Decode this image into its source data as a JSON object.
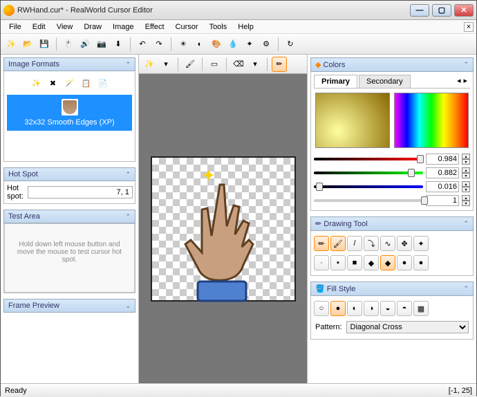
{
  "title": "RWHand.cur* - RealWorld Cursor Editor",
  "menu": [
    "File",
    "Edit",
    "View",
    "Draw",
    "Image",
    "Effect",
    "Cursor",
    "Tools",
    "Help"
  ],
  "panels": {
    "image_formats": {
      "title": "Image Formats",
      "item": "32x32 Smooth Edges (XP)"
    },
    "hot_spot": {
      "title": "Hot Spot",
      "label": "Hot spot:",
      "value": "7, 1"
    },
    "test_area": {
      "title": "Test Area",
      "hint": "Hold down left mouse button and move the mouse to test cursor hot spot."
    },
    "frame_preview": {
      "title": "Frame Preview"
    },
    "colors": {
      "title": "Colors",
      "tabs": [
        "Primary",
        "Secondary"
      ],
      "sliders": [
        {
          "value": "0.984",
          "pos": 94,
          "color": "#c00"
        },
        {
          "value": "0.882",
          "pos": 86,
          "color": "#0a0"
        },
        {
          "value": "0.016",
          "pos": 2,
          "color": "#00c"
        },
        {
          "value": "1",
          "pos": 98,
          "color": "#888"
        }
      ]
    },
    "drawing_tool": {
      "title": "Drawing Tool"
    },
    "fill_style": {
      "title": "Fill Style",
      "pattern_label": "Pattern:",
      "pattern_value": "Diagonal Cross"
    }
  },
  "status": {
    "ready": "Ready",
    "coords": "[-1, 25]"
  }
}
